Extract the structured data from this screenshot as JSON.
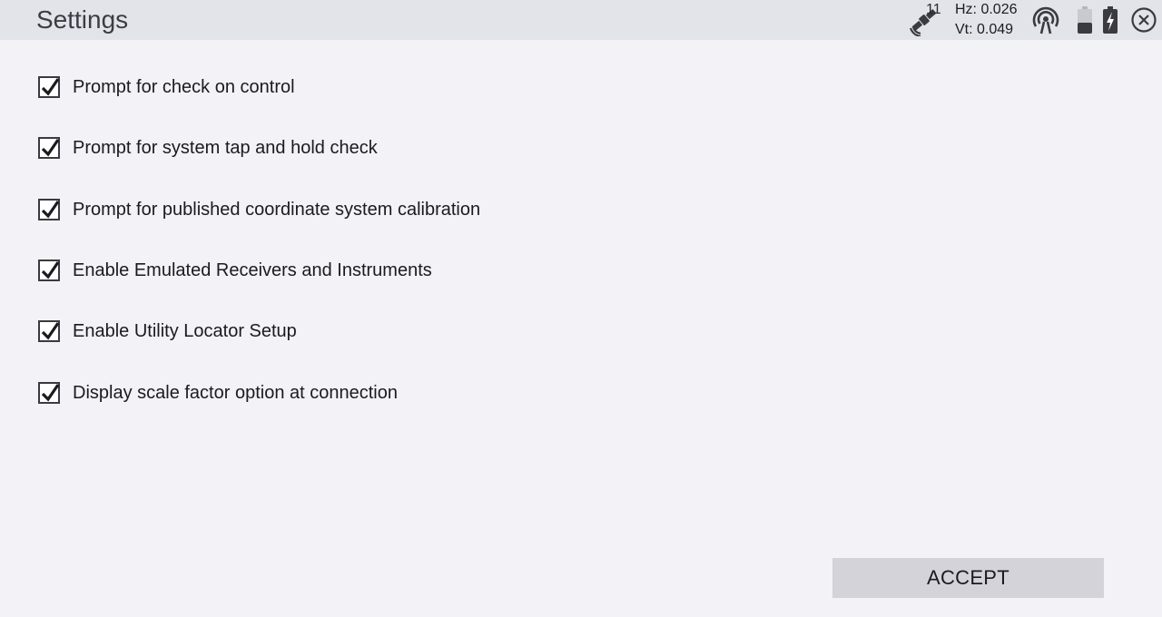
{
  "header": {
    "title": "Settings",
    "satellite_count": "11",
    "hz_precision": "Hz: 0.026",
    "vt_precision": "Vt: 0.049"
  },
  "options": [
    {
      "label": "Prompt for check on control",
      "checked": true
    },
    {
      "label": "Prompt for system tap and hold check",
      "checked": true
    },
    {
      "label": "Prompt for published coordinate system calibration",
      "checked": true
    },
    {
      "label": "Enable Emulated Receivers and Instruments",
      "checked": true
    },
    {
      "label": "Enable Utility Locator Setup",
      "checked": true
    },
    {
      "label": "Display scale factor option at connection",
      "checked": true
    }
  ],
  "accept_label": "ACCEPT",
  "icons": {
    "satellite": "satellite-icon",
    "radio": "radio-signal-icon",
    "battery_low": "battery-icon",
    "battery_charging": "battery-charging-icon",
    "close": "close-icon"
  },
  "colors": {
    "background": "#f2f2f7",
    "header": "#e3e3ea",
    "button": "#d3d3d9"
  }
}
